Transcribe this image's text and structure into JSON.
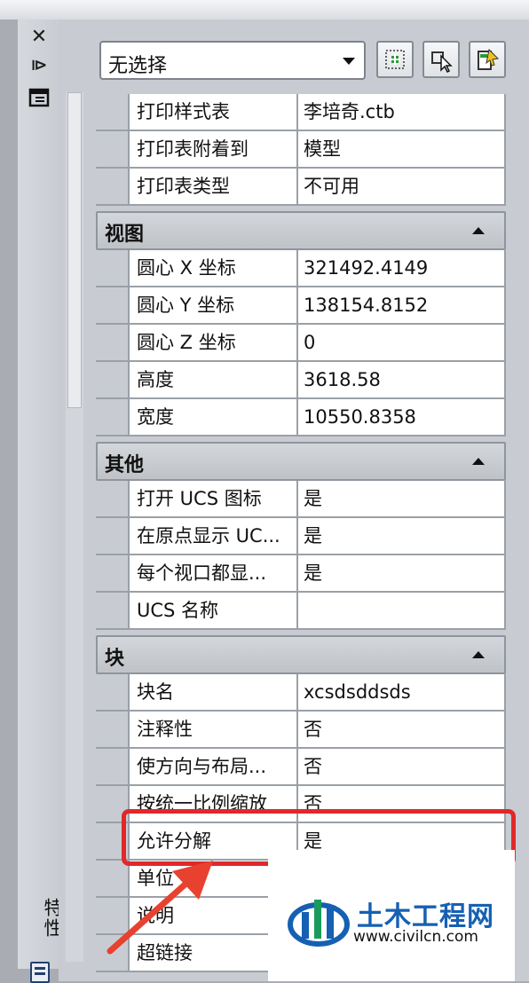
{
  "selection": {
    "value": "无选择"
  },
  "sidebar": {
    "title": "特性"
  },
  "sections": [
    {
      "id": "print",
      "label": null,
      "rows": [
        {
          "name": "打印样式表",
          "value": "李培奇.ctb"
        },
        {
          "name": "打印表附着到",
          "value": "模型"
        },
        {
          "name": "打印表类型",
          "value": "不可用"
        }
      ]
    },
    {
      "id": "view",
      "label": "视图",
      "rows": [
        {
          "name": "圆心 X 坐标",
          "value": "321492.4149"
        },
        {
          "name": "圆心 Y 坐标",
          "value": "138154.8152"
        },
        {
          "name": "圆心 Z 坐标",
          "value": "0"
        },
        {
          "name": "高度",
          "value": "3618.58"
        },
        {
          "name": "宽度",
          "value": "10550.8358"
        }
      ]
    },
    {
      "id": "misc",
      "label": "其他",
      "rows": [
        {
          "name": "打开 UCS 图标",
          "value": "是"
        },
        {
          "name": "在原点显示 UC...",
          "value": "是"
        },
        {
          "name": "每个视口都显...",
          "value": "是"
        },
        {
          "name": "UCS 名称",
          "value": ""
        }
      ]
    },
    {
      "id": "block",
      "label": "块",
      "rows": [
        {
          "name": "块名",
          "value": "xcsdsddsds"
        },
        {
          "name": "注释性",
          "value": "否"
        },
        {
          "name": "使方向与布局...",
          "value": "否"
        },
        {
          "name": "按统一比例缩放",
          "value": "否"
        },
        {
          "name": "允许分解",
          "value": "是"
        },
        {
          "name": "单位",
          "value": ""
        },
        {
          "name": "说明",
          "value": ""
        },
        {
          "name": "超链接",
          "value": ""
        }
      ]
    }
  ],
  "watermark": {
    "title": "土木工程网",
    "url": "www.civilcn.com"
  },
  "colors": {
    "highlight": "#e0282b",
    "arrow": "#e8412f",
    "brand": "#1560b3"
  },
  "icons": [
    "close-icon",
    "auto-hide-icon",
    "properties-menu-icon",
    "quick-select-icon",
    "select-objects-icon",
    "pickadd-toggle-icon"
  ]
}
